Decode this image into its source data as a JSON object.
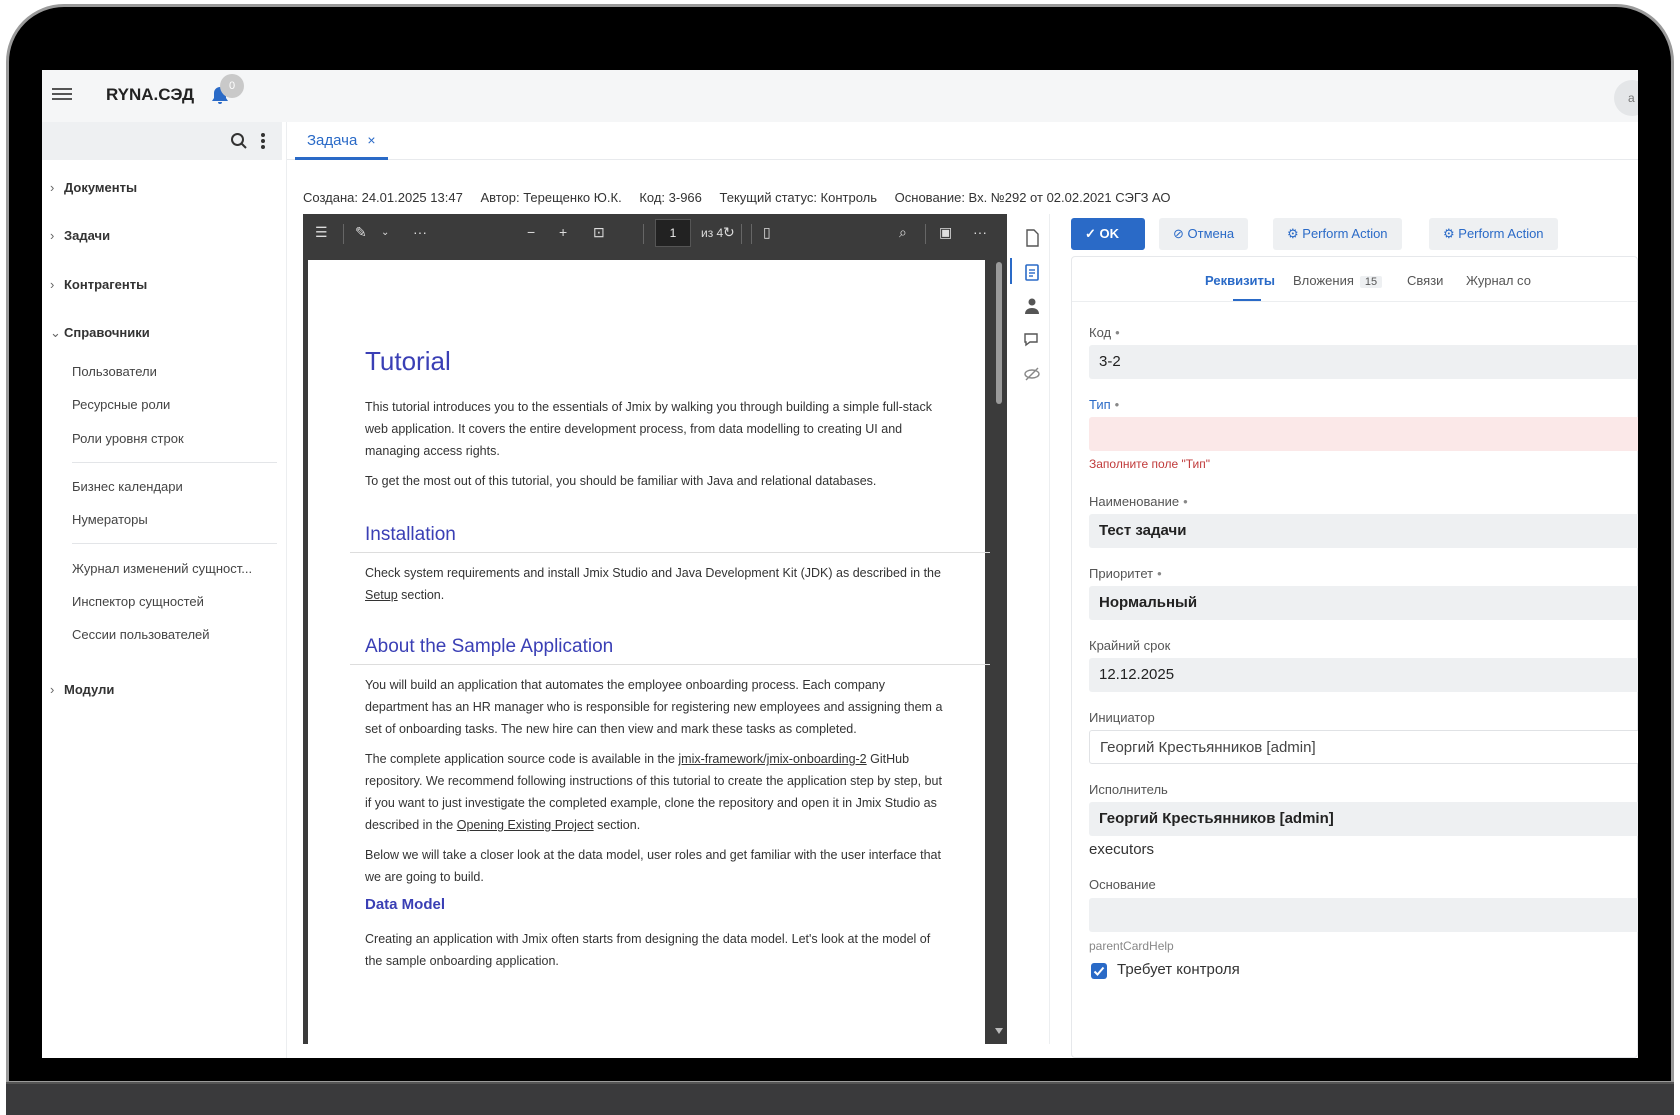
{
  "app": {
    "title": "RYNA.СЭД",
    "notifications": "0",
    "avatar_letter": "a"
  },
  "sidebar": {
    "groups": [
      {
        "label": "Документы",
        "chev": "›"
      },
      {
        "label": "Задачи",
        "chev": "›"
      },
      {
        "label": "Контрагенты",
        "chev": "›"
      },
      {
        "label": "Справочники",
        "chev": "⌄"
      },
      {
        "label": "Модули",
        "chev": "›"
      }
    ],
    "items": [
      "Пользователи",
      "Ресурсные роли",
      "Роли уровня строк",
      "Бизнес календари",
      "Нумераторы",
      "Журнал изменений сущност...",
      "Инспектор сущностей",
      "Сессии пользователей"
    ]
  },
  "tab": {
    "label": "Задача",
    "close": "×"
  },
  "meta": {
    "created": "Создана: 24.01.2025 13:47",
    "author": "Автор: Терещенко Ю.К.",
    "code": "Код: 3-966",
    "status": "Текущий статус: Контроль",
    "basis": "Основание: Вх. №292 от 02.02.2021 СЭГЗ АО"
  },
  "pdf": {
    "page": "1",
    "page_count": "из 4",
    "doc": {
      "title": "Tutorial",
      "p1": "This tutorial introduces you to the essentials of Jmix by walking you through building a simple full-stack web application. It covers the entire development process, from data modelling to creating UI and managing access rights.",
      "p2": "To get the most out of this tutorial, you should be familiar with Java and relational databases.",
      "h_install": "Installation",
      "p3_a": "Check system requirements and install Jmix Studio and Java Development Kit (JDK) as described in the ",
      "p3_link": "Setup",
      "p3_b": " section.",
      "h_about": "About the Sample Application",
      "p4": "You will build an application that automates the employee onboarding process. Each company department has an HR manager who is responsible for registering new employees and assigning them a set of onboarding tasks. The new hire can then view and mark these tasks as completed.",
      "p5_a": "The complete application source code is available in the ",
      "p5_link": "jmix-framework/jmix-onboarding-2",
      "p5_b": " GitHub repository. We recommend following instructions of this tutorial to create the application step by step, but if you want to just investigate the completed example, clone the repository and open it in Jmix Studio as described in the ",
      "p5_link2": "Opening Existing Project",
      "p5_c": " section.",
      "p6": "Below we will take a closer look at the data model, user roles and get familiar with the user interface that we are going to build.",
      "h_data": "Data Model",
      "p7": "Creating an application with Jmix often starts from designing the data model. Let's look at the model of the sample onboarding application."
    }
  },
  "actions": {
    "ok": "OK",
    "cancel": "Отмена",
    "perform1": "Perform Action",
    "perform2": "Perform Action"
  },
  "form": {
    "tabs": {
      "details": "Реквизиты",
      "attachments": "Вложения",
      "attachments_count": "15",
      "links": "Связи",
      "journal": "Журнал со"
    },
    "code_label": "Код",
    "code_value": "3-2",
    "type_label": "Тип",
    "type_error": "Заполните поле \"Тип\"",
    "name_label": "Наименование",
    "name_value": "Тест задачи",
    "priority_label": "Приоритет",
    "priority_value": "Нормальный",
    "deadline_label": "Крайний срок",
    "deadline_value": "12.12.2025",
    "initiator_label": "Инициатор",
    "initiator_value": "Георгий Крестьянников [admin]",
    "executor_label": "Исполнитель",
    "executor_value": "Георгий Крестьянников [admin]",
    "executors_text": "executors",
    "basis_label": "Основание",
    "parent_hint": "parentCardHelp",
    "control_label": "Требует контроля",
    "required_mark": "•"
  },
  "colors": {
    "accent": "#2a6ac7",
    "error": "#c03a3a",
    "doc_heading": "#3a3fb5"
  }
}
